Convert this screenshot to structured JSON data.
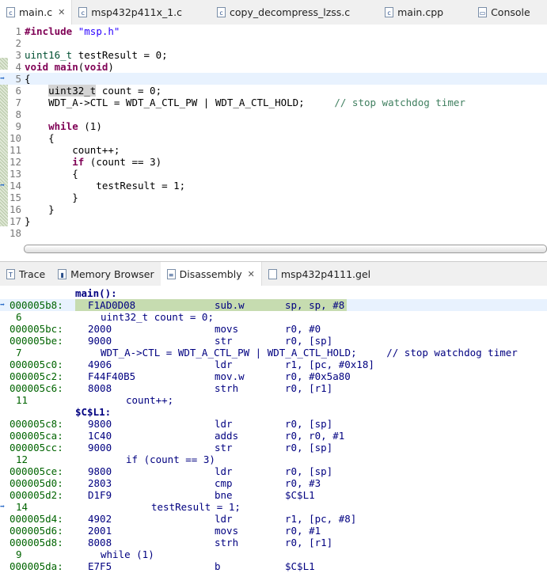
{
  "editor_tabs": [
    {
      "label": "main.c",
      "icon": "c-file-icon",
      "active": true
    },
    {
      "label": "msp432p411x_1.c",
      "icon": "c-file-icon"
    },
    {
      "label": "copy_decompress_lzss.c",
      "icon": "c-file-icon"
    },
    {
      "label": "main.cpp",
      "icon": "c-file-icon"
    },
    {
      "label": "Console",
      "icon": "console-icon"
    }
  ],
  "editor_lines": [
    {
      "n": "1",
      "t": [
        [
          "kw",
          "#include"
        ],
        [
          "",
          " "
        ],
        [
          "str",
          "\"msp.h\""
        ]
      ]
    },
    {
      "n": "2",
      "t": []
    },
    {
      "n": "3",
      "t": [
        [
          "tp",
          "uint16_t"
        ],
        [
          "",
          " testResult = 0;"
        ]
      ]
    },
    {
      "n": "4",
      "t": [
        [
          "kw",
          "void"
        ],
        [
          "",
          " "
        ],
        [
          "kw",
          "main"
        ],
        [
          "",
          "("
        ],
        [
          "kw",
          "void"
        ],
        [
          "",
          ")"
        ]
      ]
    },
    {
      "n": "5",
      "t": [
        [
          "",
          "{"
        ]
      ],
      "cur": true,
      "arrow": true
    },
    {
      "n": "6",
      "t": [
        [
          "",
          "    "
        ],
        [
          "hl",
          "uint32_t"
        ],
        [
          "",
          " count = 0;"
        ]
      ]
    },
    {
      "n": "7",
      "t": [
        [
          "",
          "    WDT_A->CTL = WDT_A_CTL_PW | WDT_A_CTL_HOLD;     "
        ],
        [
          "cm",
          "// stop watchdog timer"
        ]
      ]
    },
    {
      "n": "8",
      "t": []
    },
    {
      "n": "9",
      "t": [
        [
          "",
          "    "
        ],
        [
          "kw",
          "while"
        ],
        [
          "",
          " (1)"
        ]
      ]
    },
    {
      "n": "10",
      "t": [
        [
          "",
          "    {"
        ]
      ]
    },
    {
      "n": "11",
      "t": [
        [
          "",
          "        count++;"
        ]
      ]
    },
    {
      "n": "12",
      "t": [
        [
          "",
          "        "
        ],
        [
          "kw",
          "if"
        ],
        [
          "",
          " (count == 3)"
        ]
      ]
    },
    {
      "n": "13",
      "t": [
        [
          "",
          "        {"
        ]
      ]
    },
    {
      "n": "14",
      "t": [
        [
          "",
          "            testResult = 1;"
        ]
      ],
      "bp": true
    },
    {
      "n": "15",
      "t": [
        [
          "",
          "        }"
        ]
      ]
    },
    {
      "n": "16",
      "t": [
        [
          "",
          "    }"
        ]
      ]
    },
    {
      "n": "17",
      "t": [
        [
          "",
          "}"
        ]
      ]
    },
    {
      "n": "18",
      "t": []
    }
  ],
  "view_tabs": [
    {
      "label": "Trace",
      "icon": "trace-icon"
    },
    {
      "label": "Memory Browser",
      "icon": "memory-icon"
    },
    {
      "label": "Disassembly",
      "icon": "disassembly-icon",
      "active": true
    },
    {
      "label": "msp432p4111.gel",
      "icon": "file-icon"
    }
  ],
  "disassembly": [
    {
      "k": "label",
      "text": "main():"
    },
    {
      "k": "ins",
      "addr": "000005b8:",
      "op": "F1AD0D08",
      "mn": "sub.w",
      "opd": "sp, sp, #8",
      "cur": true
    },
    {
      "k": "src",
      "num": "6",
      "text": "uint32_t count = 0;",
      "ind": 1
    },
    {
      "k": "ins",
      "addr": "000005bc:",
      "op": "2000",
      "mn": "movs",
      "opd": "r0, #0"
    },
    {
      "k": "ins",
      "addr": "000005be:",
      "op": "9000",
      "mn": "str",
      "opd": "r0, [sp]"
    },
    {
      "k": "src",
      "num": "7",
      "text": "WDT_A->CTL = WDT_A_CTL_PW | WDT_A_CTL_HOLD;     // stop watchdog timer",
      "ind": 1
    },
    {
      "k": "ins",
      "addr": "000005c0:",
      "op": "4906",
      "mn": "ldr",
      "opd": "r1, [pc, #0x18]"
    },
    {
      "k": "ins",
      "addr": "000005c2:",
      "op": "F44F40B5",
      "mn": "mov.w",
      "opd": "r0, #0x5a80"
    },
    {
      "k": "ins",
      "addr": "000005c6:",
      "op": "8008",
      "mn": "strh",
      "opd": "r0, [r1]"
    },
    {
      "k": "src",
      "num": "11",
      "text": "count++;",
      "ind": 2
    },
    {
      "k": "label",
      "text": "$C$L1:"
    },
    {
      "k": "ins",
      "addr": "000005c8:",
      "op": "9800",
      "mn": "ldr",
      "opd": "r0, [sp]"
    },
    {
      "k": "ins",
      "addr": "000005ca:",
      "op": "1C40",
      "mn": "adds",
      "opd": "r0, r0, #1"
    },
    {
      "k": "ins",
      "addr": "000005cc:",
      "op": "9000",
      "mn": "str",
      "opd": "r0, [sp]"
    },
    {
      "k": "src",
      "num": "12",
      "text": "if (count == 3)",
      "ind": 2
    },
    {
      "k": "ins",
      "addr": "000005ce:",
      "op": "9800",
      "mn": "ldr",
      "opd": "r0, [sp]"
    },
    {
      "k": "ins",
      "addr": "000005d0:",
      "op": "2803",
      "mn": "cmp",
      "opd": "r0, #3"
    },
    {
      "k": "ins",
      "addr": "000005d2:",
      "op": "D1F9",
      "mn": "bne",
      "opd": "$C$L1"
    },
    {
      "k": "src",
      "num": "14",
      "text": "testResult = 1;",
      "ind": 3,
      "bp": true
    },
    {
      "k": "ins",
      "addr": "000005d4:",
      "op": "4902",
      "mn": "ldr",
      "opd": "r1, [pc, #8]"
    },
    {
      "k": "ins",
      "addr": "000005d6:",
      "op": "2001",
      "mn": "movs",
      "opd": "r0, #1"
    },
    {
      "k": "ins",
      "addr": "000005d8:",
      "op": "8008",
      "mn": "strh",
      "opd": "r0, [r1]"
    },
    {
      "k": "src",
      "num": "9",
      "text": "while (1)",
      "ind": 1
    },
    {
      "k": "ins",
      "addr": "000005da:",
      "op": "E7F5",
      "mn": "b",
      "opd": "$C$L1"
    }
  ]
}
